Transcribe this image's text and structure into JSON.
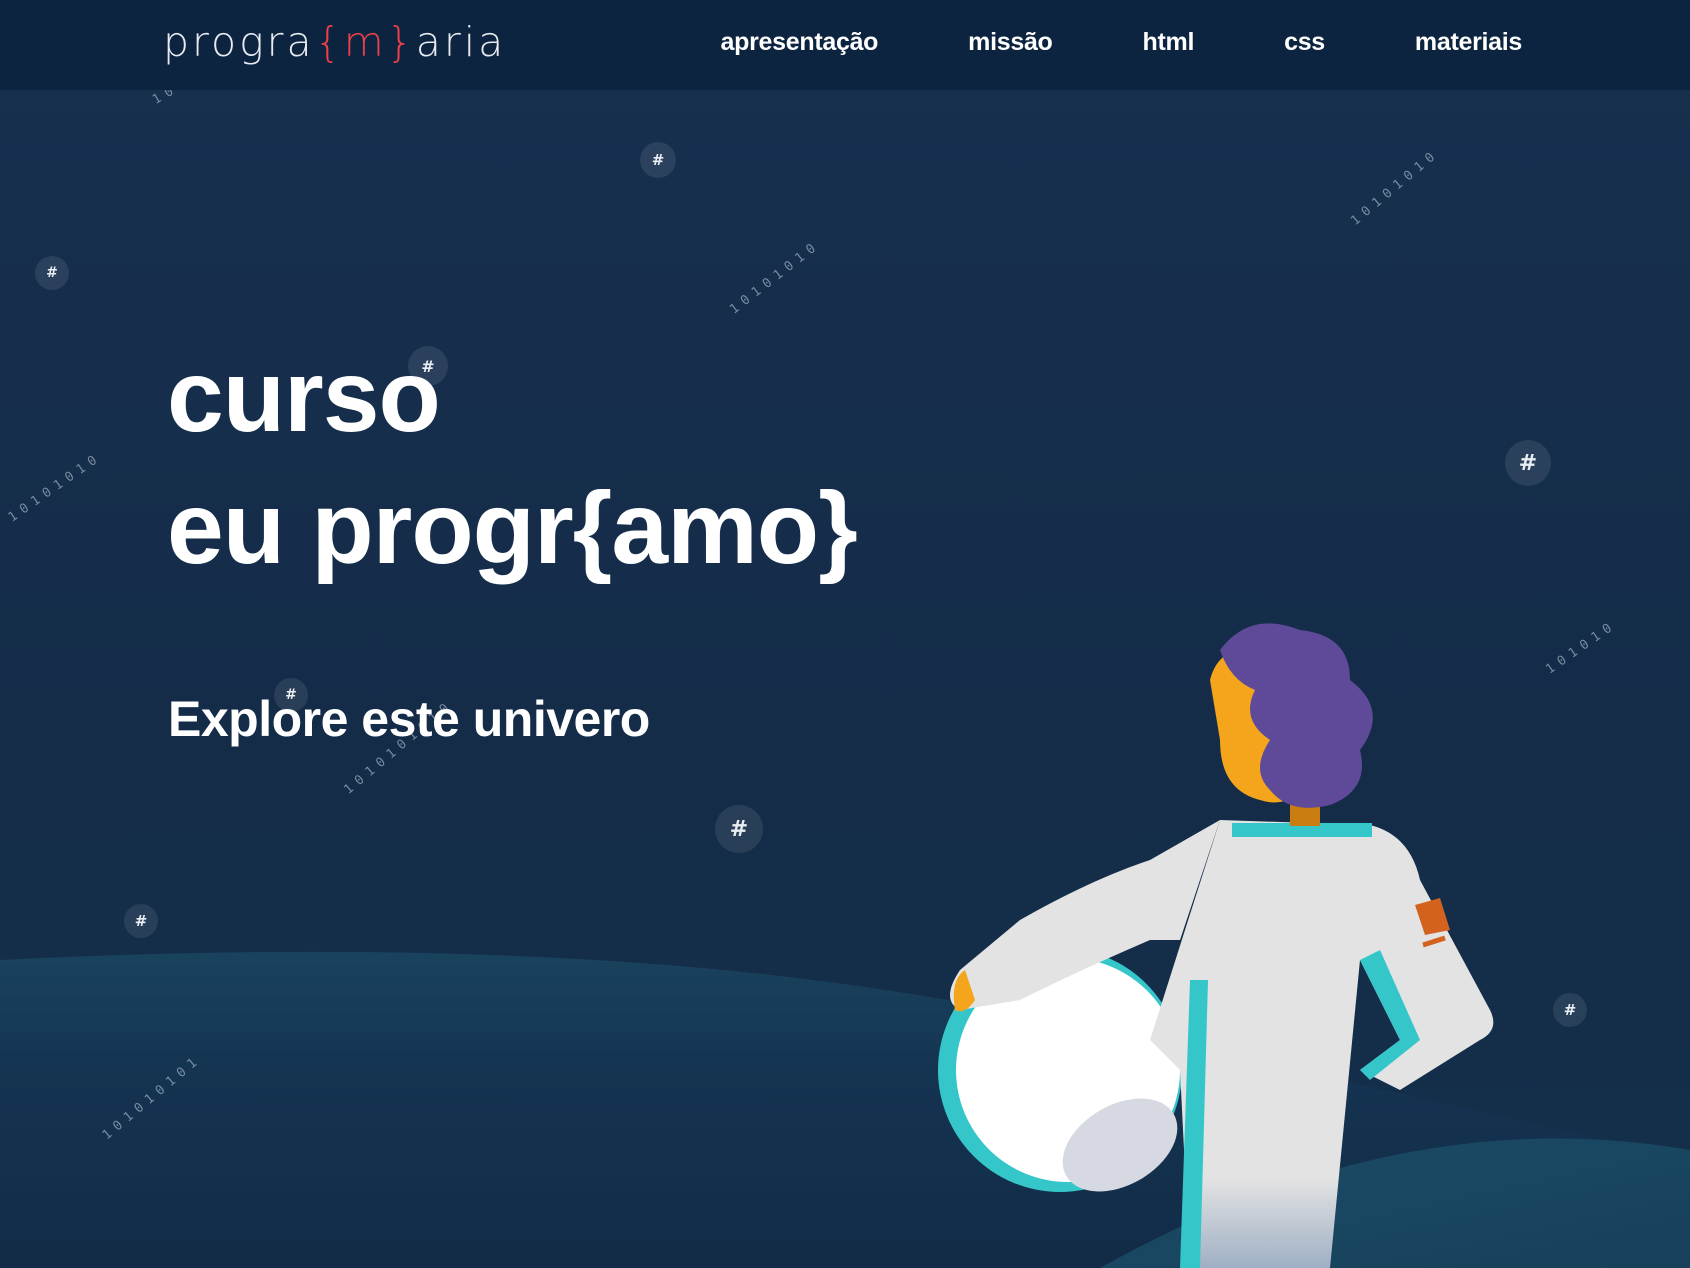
{
  "header": {
    "logo": {
      "part1": "progra",
      "accent": "{m}",
      "part2": "aria"
    },
    "nav": [
      {
        "label": "apresentação"
      },
      {
        "label": "missão"
      },
      {
        "label": "html"
      },
      {
        "label": "css"
      },
      {
        "label": "materiais"
      }
    ]
  },
  "hero": {
    "title_line1": "curso",
    "title_line2": "eu progr{amo}",
    "subtitle": "Explore este univero"
  },
  "decor": {
    "hash_symbol": "#",
    "binary_digits": [
      "1",
      "0",
      "1",
      "0",
      "1",
      "0",
      "1",
      "0",
      "1",
      "0",
      "1",
      "0"
    ]
  },
  "colors": {
    "background": "#142c48",
    "header": "#0d2440",
    "logo_accent": "#e8414b",
    "hair": "#5f4a9a",
    "skin": "#f4a51c",
    "suit": "#e3e3e3",
    "suit_trim": "#35c6c9",
    "patch": "#d4621f"
  }
}
